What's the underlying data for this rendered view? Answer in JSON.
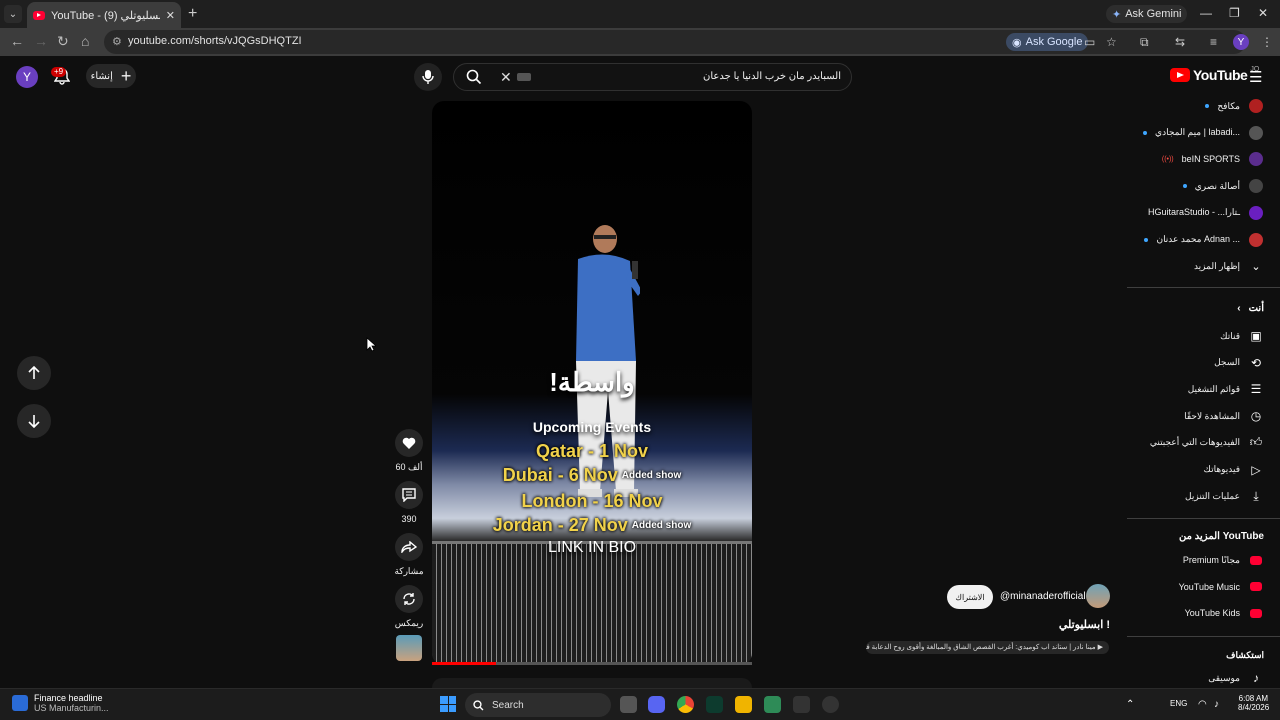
{
  "browser": {
    "tab_title": "YouTube - ابسليوتلي (9) l",
    "tab_close": "✕",
    "new_tab": "+",
    "ask_gemini": "Ask Gemini",
    "url": "youtube.com/shorts/vJQGsDHQTZI",
    "ask_google": "Ask Google",
    "profile_letter": "Y"
  },
  "masthead": {
    "avatar_letter": "Y",
    "notif_count": "+9",
    "create_label": "إنشاء",
    "search_query": "السبايدر مان خرب الدنيا يا جدعان",
    "logo_text": "YouTube",
    "country_code": "JO"
  },
  "video": {
    "overlay_title": "!واسطة",
    "upcoming": "Upcoming Events",
    "events": [
      {
        "text": "Qatar - 1 Nov",
        "added": ""
      },
      {
        "text": "Dubai - 6 Nov",
        "added": "Added show"
      },
      {
        "text": "London - 16 Nov",
        "added": ""
      },
      {
        "text": "Jordan - 27 Nov",
        "added": "Added show"
      }
    ],
    "link_in_bio": "LINK IN BIO",
    "progress_fraction": 0.2
  },
  "actions": {
    "likes": "60 ألف",
    "comments": "390",
    "share": "مشاركة",
    "remix": "ريمكس"
  },
  "channel": {
    "subscribe": "الاشتراك",
    "handle": "@minanaderofficial",
    "title": "ابسليوتلي !",
    "music": "▶ مينا نادر | ستاند اب كوميدي: أغرب القصص الشاق والمبالغة وأقوى روح الدعابة في العربية"
  },
  "sidebar": {
    "subscriptions": [
      {
        "label": "مكافح",
        "color": "#b02020",
        "dot": true
      },
      {
        "label": "ميم المجادي | labadi...",
        "color": "#555555",
        "dot": true
      },
      {
        "label": "beIN SPORTS",
        "color": "#5b2d8e",
        "dot": false,
        "live": true
      },
      {
        "label": "أصالة نصري",
        "color": "#444444",
        "dot": true
      },
      {
        "label": "HGuitaraStudio - ...ـتارا",
        "color": "#6a1fc0",
        "dot": false
      },
      {
        "label": "محمد عدنان Adnan ...",
        "color": "#c03030",
        "dot": true
      }
    ],
    "show_more": "إظهار المزيد",
    "you_header": "أنت",
    "you_items": [
      {
        "label": "قناتك",
        "icon": "person-box-icon"
      },
      {
        "label": "السجل",
        "icon": "history-icon"
      },
      {
        "label": "قوائم التشغيل",
        "icon": "playlist-icon"
      },
      {
        "label": "المشاهدة لاحقًا",
        "icon": "clock-icon"
      },
      {
        "label": "الفيديوهات التي أعجبتني",
        "icon": "thumb-up-icon"
      },
      {
        "label": "فيديوهاتك",
        "icon": "play-box-icon"
      },
      {
        "label": "عمليات التنزيل",
        "icon": "download-icon"
      }
    ],
    "more_header": "المزيد من YouTube",
    "more_items": [
      {
        "label": "Premium مجانًا",
        "color": "#ff0033"
      },
      {
        "label": "YouTube Music",
        "color": "#ff0033"
      },
      {
        "label": "YouTube Kids",
        "color": "#ff0033"
      }
    ],
    "explore_header": "استكشاف",
    "explore_items": [
      {
        "label": "موسيقى",
        "icon": "music-note-icon"
      }
    ]
  },
  "taskbar": {
    "news_title": "Finance headline",
    "news_sub": "US Manufacturin...",
    "search_label": "Search",
    "lang": "ENG",
    "time": "6:08 AM",
    "date": "8/4/2026"
  }
}
